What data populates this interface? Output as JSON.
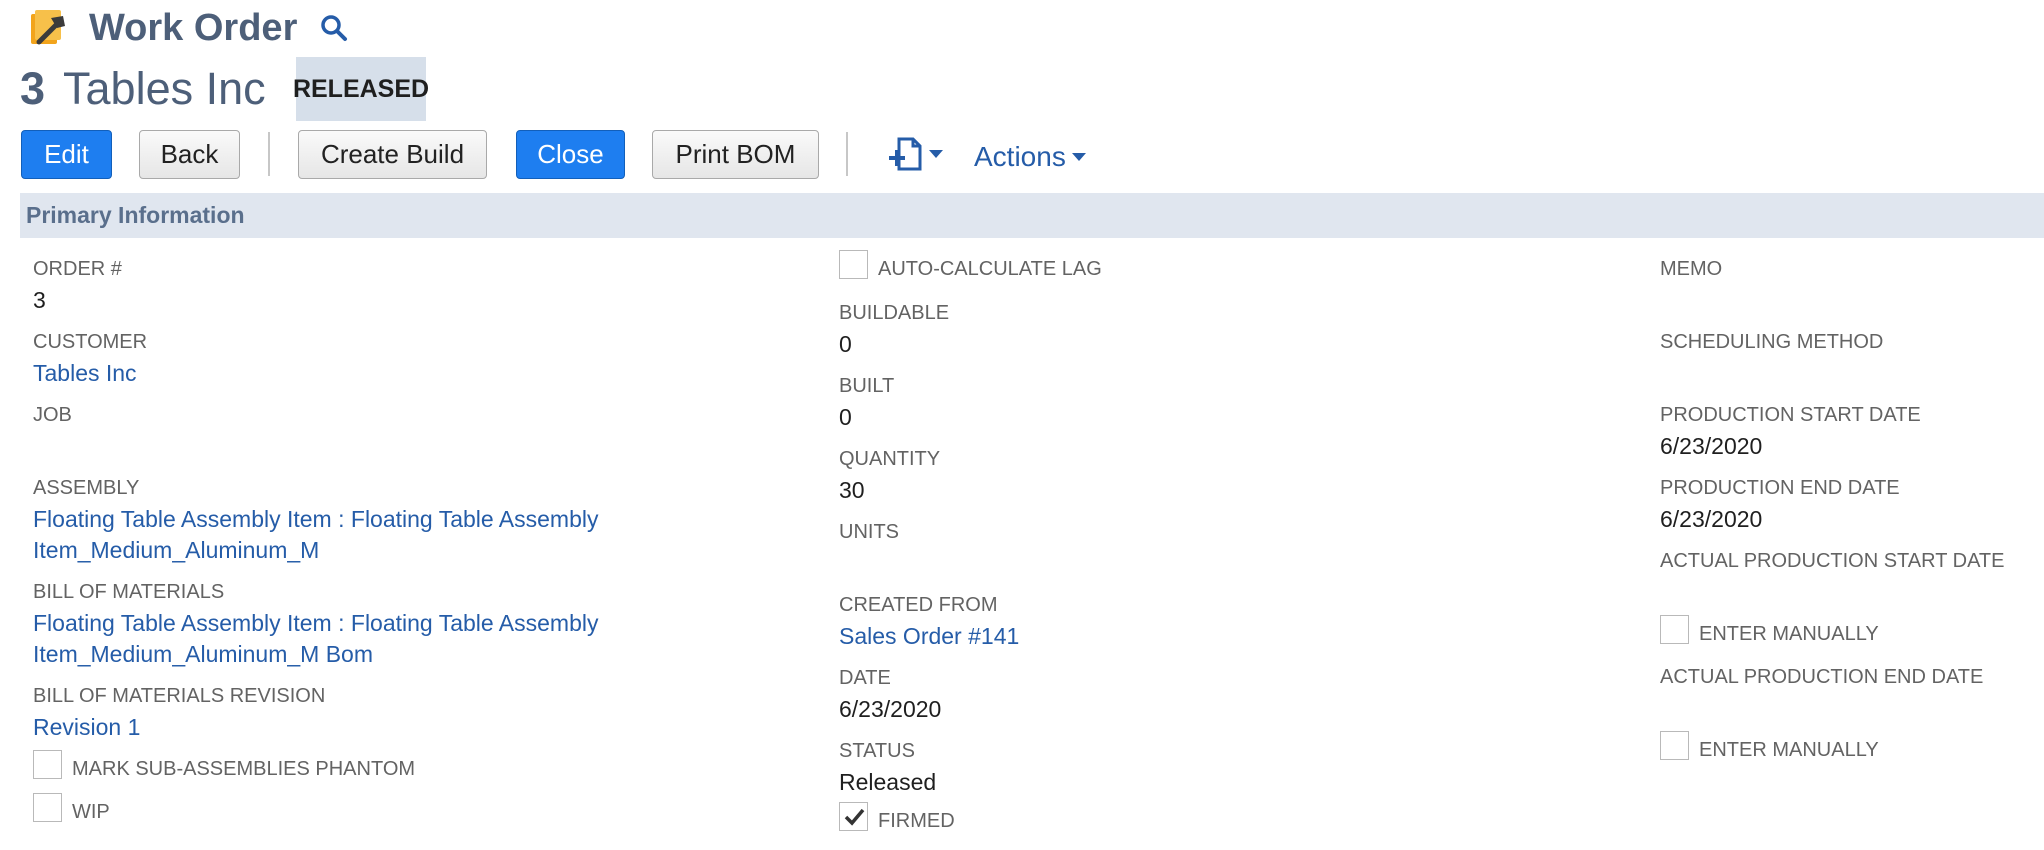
{
  "header": {
    "title": "Work Order",
    "record_number": "3",
    "record_name": "Tables Inc",
    "status": "RELEASED"
  },
  "toolbar": {
    "edit": "Edit",
    "back": "Back",
    "create_build": "Create Build",
    "close": "Close",
    "print_bom": "Print BOM",
    "actions": "Actions"
  },
  "section": {
    "title": "Primary Information"
  },
  "left": {
    "order_label": "ORDER #",
    "order_value": "3",
    "customer_label": "CUSTOMER",
    "customer_value": "Tables Inc",
    "job_label": "JOB",
    "assembly_label": "ASSEMBLY",
    "assembly_line1": "Floating Table Assembly Item : Floating Table Assembly",
    "assembly_line2": "Item_Medium_Aluminum_M",
    "bom_label": "BILL OF MATERIALS",
    "bom_line1": "Floating Table Assembly Item : Floating Table Assembly",
    "bom_line2": "Item_Medium_Aluminum_M Bom",
    "bom_rev_label": "BILL OF MATERIALS REVISION",
    "bom_rev_value": "Revision 1",
    "mark_phantom_label": "MARK SUB-ASSEMBLIES PHANTOM",
    "wip_label": "WIP"
  },
  "middle": {
    "auto_lag_label": "AUTO-CALCULATE LAG",
    "buildable_label": "BUILDABLE",
    "buildable_value": "0",
    "built_label": "BUILT",
    "built_value": "0",
    "quantity_label": "QUANTITY",
    "quantity_value": "30",
    "units_label": "UNITS",
    "created_from_label": "CREATED FROM",
    "created_from_value": "Sales Order #141",
    "date_label": "DATE",
    "date_value": "6/23/2020",
    "status_label": "STATUS",
    "status_value": "Released",
    "firmed_label": "FIRMED",
    "firmed_checked": true
  },
  "right": {
    "memo_label": "MEMO",
    "scheduling_label": "SCHEDULING METHOD",
    "prod_start_label": "PRODUCTION START DATE",
    "prod_start_value": "6/23/2020",
    "prod_end_label": "PRODUCTION END DATE",
    "prod_end_value": "6/23/2020",
    "actual_start_label": "ACTUAL PRODUCTION START DATE",
    "enter_manually_label_1": "ENTER MANUALLY",
    "actual_end_label": "ACTUAL PRODUCTION END DATE",
    "enter_manually_label_2": "ENTER MANUALLY"
  },
  "colors": {
    "primary_button": "#1e7ef0",
    "link": "#255ca8",
    "title": "#4d5f79",
    "section_bar": "#e0e6ef",
    "status_badge": "#d6dfea"
  }
}
